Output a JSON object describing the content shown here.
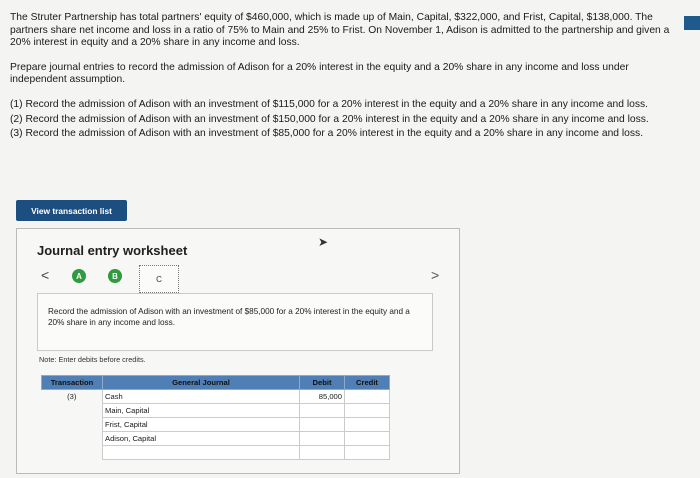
{
  "problem": {
    "intro": "The Struter Partnership has total partners' equity of $460,000, which is made up of Main, Capital, $322,000, and Frist, Capital, $138,000. The partners share net income and loss in a ratio of 75% to Main and 25% to Frist. On November 1, Adison is admitted to the partnership and given a 20% interest in equity and a 20% share in any income and loss.",
    "prompt": "Prepare journal entries to record the admission of Adison for a 20% interest in the equity and a 20% share in any income and loss under independent assumption.",
    "tasks": [
      "(1) Record the admission of Adison with an investment of $115,000 for a 20% interest in the equity and a 20% share in any income and loss.",
      "(2) Record the admission of Adison with an investment of $150,000 for a 20% interest in the equity and a 20% share in any income and loss.",
      "(3) Record the admission of Adison with an investment of $85,000 for a 20% interest in the equity and a 20% share in any income and loss."
    ]
  },
  "view_transaction_list_label": "View transaction list",
  "worksheet": {
    "title": "Journal entry worksheet",
    "nav_prev": "<",
    "nav_next": ">",
    "steps": [
      "A",
      "B",
      "C"
    ],
    "instruction": "Record the admission of Adison with an investment of $85,000 for a 20% interest in the equity and a 20% share in any income and loss.",
    "note": "Note: Enter debits before credits.",
    "columns": [
      "Transaction",
      "General Journal",
      "Debit",
      "Credit"
    ],
    "rows": [
      {
        "transaction": "(3)",
        "account": "Cash",
        "debit": "85,000",
        "credit": ""
      },
      {
        "transaction": "",
        "account": "Main, Capital",
        "debit": "",
        "credit": ""
      },
      {
        "transaction": "",
        "account": "Frist, Capital",
        "debit": "",
        "credit": ""
      },
      {
        "transaction": "",
        "account": "Adison, Capital",
        "debit": "",
        "credit": ""
      },
      {
        "transaction": "",
        "account": "",
        "debit": "",
        "credit": ""
      }
    ]
  }
}
